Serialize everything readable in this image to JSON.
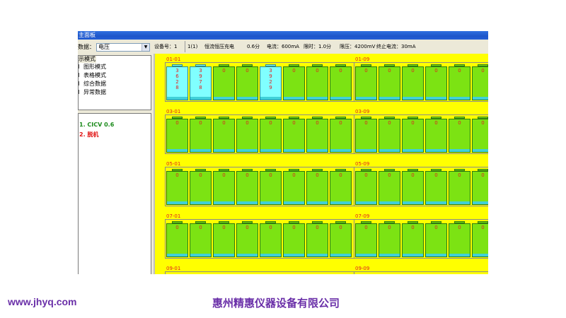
{
  "window": {
    "title": "主面板"
  },
  "left_panel": {
    "data_label": "数据：",
    "data_select_value": "电压",
    "mode_group_label": "示模式",
    "modes": [
      "图形模式",
      "表格模式",
      "综合数据",
      "异常数据"
    ],
    "status_items": [
      {
        "text": "1. CICV  0.6",
        "color": "#1a8a1a"
      },
      {
        "text": "2. 脱机",
        "color": "#e01010"
      }
    ]
  },
  "info_bar": {
    "device_no": "设备号：1",
    "step": "1(1)",
    "mode": "恒流恒压充电",
    "duration": "0.6分",
    "current": "电流：600mA",
    "time_limit": "限时：1.0分",
    "voltage_limit": "限压：4200mV",
    "cutoff_current": "终止电流：30mA"
  },
  "grid": {
    "rows": [
      {
        "left_label": "01-01",
        "right_label": "01-09",
        "values": [
          "3628",
          "3978",
          "0",
          "0",
          "3929",
          "0",
          "0",
          "0",
          "0",
          "0",
          "0",
          "0",
          "0",
          "0"
        ],
        "active": [
          true,
          true,
          false,
          false,
          true,
          false,
          false,
          false,
          false,
          false,
          false,
          false,
          false,
          false
        ]
      },
      {
        "left_label": "03-01",
        "right_label": "03-09",
        "values": [
          "0",
          "0",
          "0",
          "0",
          "0",
          "0",
          "0",
          "0",
          "0",
          "0",
          "0",
          "0",
          "0",
          "0"
        ],
        "active": [
          false,
          false,
          false,
          false,
          false,
          false,
          false,
          false,
          false,
          false,
          false,
          false,
          false,
          false
        ]
      },
      {
        "left_label": "05-01",
        "right_label": "05-09",
        "values": [
          "0",
          "0",
          "0",
          "0",
          "0",
          "0",
          "0",
          "0",
          "0",
          "0",
          "0",
          "0",
          "0",
          "0"
        ],
        "active": [
          false,
          false,
          false,
          false,
          false,
          false,
          false,
          false,
          false,
          false,
          false,
          false,
          false,
          false
        ]
      },
      {
        "left_label": "07-01",
        "right_label": "07-09",
        "values": [
          "0",
          "0",
          "0",
          "0",
          "0",
          "0",
          "0",
          "0",
          "0",
          "0",
          "0",
          "0",
          "0",
          "0"
        ],
        "active": [
          false,
          false,
          false,
          false,
          false,
          false,
          false,
          false,
          false,
          false,
          false,
          false,
          false,
          false
        ]
      },
      {
        "left_label": "09-01",
        "right_label": "09-09",
        "values": [],
        "active": []
      }
    ],
    "colors": {
      "background": "#ffff00",
      "cell": "#7ce313",
      "cell_active": "#80ffff",
      "base": "#40d0d8",
      "value_text": "#e02020"
    }
  },
  "footer": {
    "url": "www.jhyq.com",
    "company": "惠州精惠仪器设备有限公司"
  }
}
